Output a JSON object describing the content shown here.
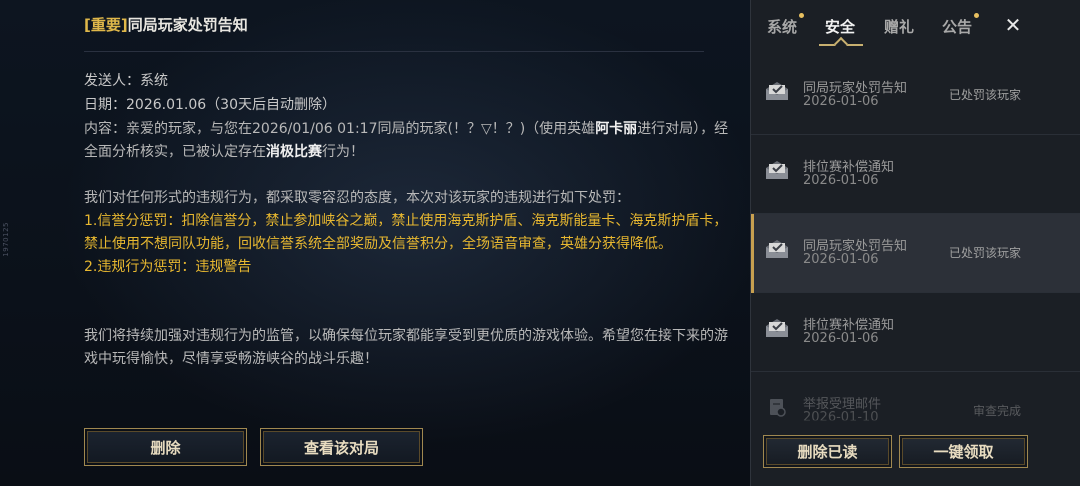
{
  "side_mark": "1970125",
  "mail_detail": {
    "tag": "[重要]",
    "title": "同局玩家处罚告知",
    "sender": "发送人：系统",
    "date": "日期：2026.01.06（30天后自动删除）",
    "content_p1_a": "内容：亲爱的玩家，与您在2026/01/06 01:17同局的玩家(！？▽！？)（使用英雄",
    "content_p1_hero": "阿卡丽",
    "content_p1_b": "进行对局），经全面分析核实，已被认定存在",
    "content_p1_violation": "消极比赛",
    "content_p1_c": "行为！",
    "content_p2": "我们对任何形式的违规行为，都采取零容忍的态度，本次对该玩家的违规进行如下处罚：",
    "penalty_1": "1.信誉分惩罚：扣除信誉分，禁止参加峡谷之巅，禁止使用海克斯护盾、海克斯能量卡、海克斯护盾卡，禁止使用不想同队功能，回收信誉系统全部奖励及信誉积分，全场语音审查，英雄分获得降低。",
    "penalty_2": "2.违规行为惩罚：违规警告",
    "content_p3": "我们将持续加强对违规行为的监管，以确保每位玩家都能享受到更优质的游戏体验。希望您在接下来的游戏中玩得愉快，尽情享受畅游峡谷的战斗乐趣！",
    "delete_label": "删除",
    "view_match_label": "查看该对局"
  },
  "tabs": [
    {
      "label": "系统",
      "has_dot": true
    },
    {
      "label": "安全",
      "active": true
    },
    {
      "label": "赠礼"
    },
    {
      "label": "公告",
      "has_dot": true
    }
  ],
  "close_label": "✕",
  "mails": [
    {
      "name": "同局玩家处罚告知",
      "date": "2026-01-06",
      "status": "已处罚该玩家"
    },
    {
      "name": "排位赛补偿通知",
      "date": "2026-01-06",
      "status": ""
    },
    {
      "name": "同局玩家处罚告知",
      "date": "2026-01-06",
      "status": "已处罚该玩家",
      "selected": true
    },
    {
      "name": "排位赛补偿通知",
      "date": "2026-01-06",
      "status": ""
    },
    {
      "name": "举报受理邮件",
      "date": "2026-01-10",
      "status": "审查完成"
    }
  ],
  "footer": {
    "delete_read_label": "删除已读",
    "claim_all_label": "一键领取"
  },
  "colors": {
    "accent_gold": "#e8b830",
    "tag_gold": "#e0b84a",
    "button_border": "#a08850"
  }
}
